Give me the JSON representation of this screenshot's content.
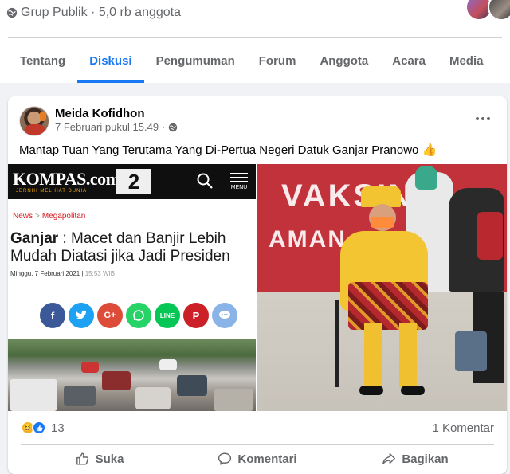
{
  "group": {
    "meta": "Grup Publik · 5,0 rb anggota"
  },
  "tabs": [
    {
      "label": "Tentang"
    },
    {
      "label": "Diskusi",
      "active": true
    },
    {
      "label": "Pengumuman"
    },
    {
      "label": "Forum"
    },
    {
      "label": "Anggota"
    },
    {
      "label": "Acara"
    },
    {
      "label": "Media"
    }
  ],
  "post": {
    "author": "Meida Kofidhon",
    "time": "7 Februari pukul 15.49 ·",
    "text": "Mantap Tuan Yang Terutama Yang Di-Pertua Negeri Datuk Ganjar Pranowo 👍",
    "reaction_count": "13",
    "comment_count": "1 Komentar"
  },
  "article_image": {
    "logo": "KOMPAS.com",
    "tagline": "JERNIH MELIHAT DUNIA",
    "badge": "2",
    "menu_label": "MENU",
    "crumb_1": "News",
    "crumb_sep": ">",
    "crumb_2": "Megapolitan",
    "headline_bold": "Ganjar",
    "headline_rest": ": Macet dan Banjir Lebih Mudah Diatasi jika Jadi Presiden",
    "date": "Minggu, 7 Februari 2021 |",
    "time": "15:53 WIB"
  },
  "photo_image": {
    "wall_text_1": "VAKSIN",
    "wall_text_2": "AMAN"
  },
  "actions": {
    "like": "Suka",
    "comment": "Komentari",
    "share": "Bagikan"
  },
  "colors": {
    "accent": "#1877f2",
    "secondary_text": "#65676b",
    "background": "#f0f2f5"
  }
}
